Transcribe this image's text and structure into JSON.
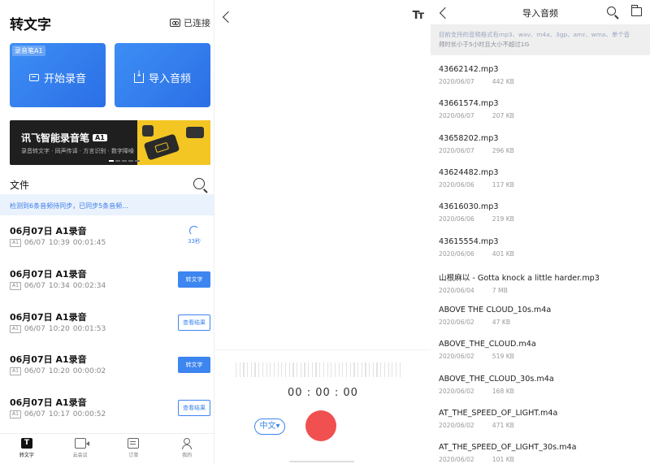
{
  "panel1": {
    "title": "转文字",
    "connection": "已连接",
    "start_badge": "录音笔A1",
    "start_label": "开始录音",
    "import_label": "导入音频",
    "banner": {
      "title": "讯飞智能录音笔",
      "badge": "A1",
      "subtitle": "录音转文字 · 同声传译 · 方言识别 · 数字降噪"
    },
    "files_label": "文件",
    "sync_text": "检测到6条音频待同步，已同步5条音频...",
    "records": [
      {
        "title": "06月07日 A1录音",
        "tag": "A1",
        "date": "06/07",
        "time": "10:39",
        "duration": "00:01:45",
        "status": "33秒"
      },
      {
        "title": "06月07日 A1录音",
        "tag": "A1",
        "date": "06/07",
        "time": "10:34",
        "duration": "00:02:34",
        "action": "转文字"
      },
      {
        "title": "06月07日 A1录音",
        "tag": "A1",
        "date": "06/07",
        "time": "10:20",
        "duration": "00:01:53",
        "action": "查看结果"
      },
      {
        "title": "06月07日 A1录音",
        "tag": "A1",
        "date": "06/07",
        "time": "10:20",
        "duration": "00:00:02",
        "action": "转文字"
      },
      {
        "title": "06月07日 A1录音",
        "tag": "A1",
        "date": "06/07",
        "time": "10:17",
        "duration": "00:00:52",
        "action": "查看结果"
      }
    ],
    "tabs": [
      "转文字",
      "云会议",
      "订单",
      "我的"
    ]
  },
  "panel2": {
    "font_icon": "Tт",
    "timer": "00 : 00 : 00",
    "language": "中文▾"
  },
  "panel3": {
    "title": "导入音频",
    "notice_a": "目前支持的音频格式有mp3、wav、m4a、3gp、amr、wma、单个音",
    "notice_b": "频时长小于5小时且大小不超过1G",
    "files": [
      {
        "name": "43662142.mp3",
        "date": "2020/06/07",
        "size": "442 KB"
      },
      {
        "name": "43661574.mp3",
        "date": "2020/06/07",
        "size": "207 KB"
      },
      {
        "name": "43658202.mp3",
        "date": "2020/06/07",
        "size": "296 KB"
      },
      {
        "name": "43624482.mp3",
        "date": "2020/06/06",
        "size": "117 KB"
      },
      {
        "name": "43616030.mp3",
        "date": "2020/06/06",
        "size": "219 KB"
      },
      {
        "name": "43615554.mp3",
        "date": "2020/06/06",
        "size": "401 KB"
      },
      {
        "name": "山根麻以 - Gotta knock a little harder.mp3",
        "date": "2020/06/04",
        "size": "7 MB"
      },
      {
        "name": "ABOVE THE CLOUD_10s.m4a",
        "date": "2020/06/02",
        "size": "47 KB"
      },
      {
        "name": "ABOVE_THE_CLOUD.m4a",
        "date": "2020/06/02",
        "size": "519 KB"
      },
      {
        "name": "ABOVE_THE_CLOUD_30s.m4a",
        "date": "2020/06/02",
        "size": "168 KB"
      },
      {
        "name": "AT_THE_SPEED_OF_LIGHT.m4a",
        "date": "2020/06/02",
        "size": "471 KB"
      },
      {
        "name": "AT_THE_SPEED_OF_LIGHT_30s.m4a",
        "date": "2020/06/02",
        "size": "101 KB"
      }
    ]
  },
  "colors": {
    "accent": "#3d85f0",
    "record": "#f05050",
    "banner_yellow": "#f3c623"
  },
  "icons": [
    "recorder-icon",
    "search-icon",
    "download-icon",
    "back-icon",
    "font-size-icon",
    "folder-icon",
    "record-button"
  ]
}
